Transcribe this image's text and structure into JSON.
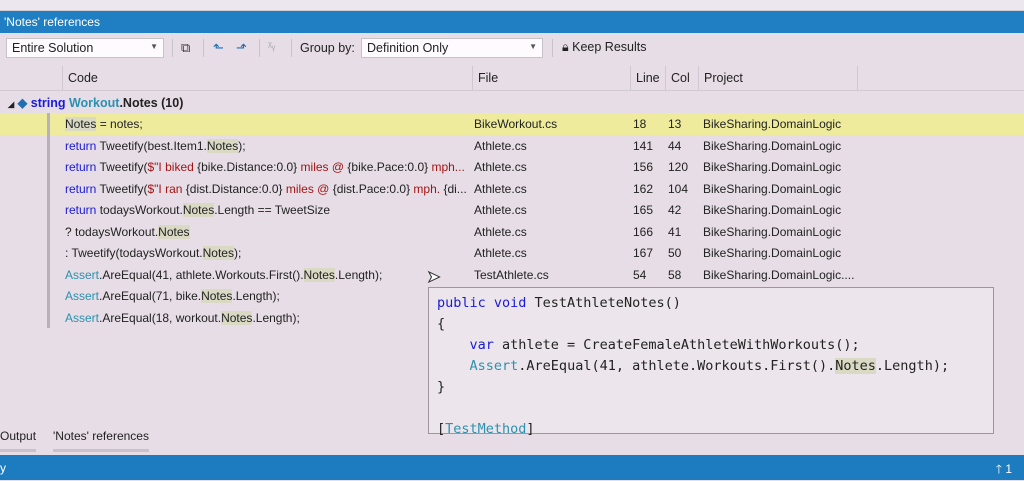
{
  "title": "'Notes' references",
  "toolbar": {
    "scope": "Entire Solution",
    "group_by_label": "Group by:",
    "group_by": "Definition Only",
    "keep_results": "Keep Results"
  },
  "columns": {
    "code": "Code",
    "file": "File",
    "line": "Line",
    "col": "Col",
    "project": "Project"
  },
  "group": {
    "kw": "string",
    "type": "Workout",
    "member": ".Notes",
    "count": "(10)"
  },
  "rows": [
    {
      "code": [
        {
          "t": "Notes",
          "c": "hl"
        },
        {
          "t": " = notes;",
          "c": ""
        }
      ],
      "file": "BikeWorkout.cs",
      "line": "18",
      "col": "13",
      "project": "BikeSharing.DomainLogic",
      "selected": true
    },
    {
      "code": [
        {
          "t": "return",
          "c": "kw"
        },
        {
          "t": " Tweetify(best.Item1.",
          "c": ""
        },
        {
          "t": "Notes",
          "c": "hl"
        },
        {
          "t": ");",
          "c": ""
        }
      ],
      "file": "Athlete.cs",
      "line": "141",
      "col": "44",
      "project": "BikeSharing.DomainLogic"
    },
    {
      "code": [
        {
          "t": "return",
          "c": "kw"
        },
        {
          "t": " Tweetify(",
          "c": ""
        },
        {
          "t": "$\"I biked ",
          "c": "str"
        },
        {
          "t": "{bike.Distance:0.0}",
          "c": ""
        },
        {
          "t": " miles @ ",
          "c": "str"
        },
        {
          "t": "{bike.Pace:0.0}",
          "c": ""
        },
        {
          "t": " mph...",
          "c": "str"
        }
      ],
      "file": "Athlete.cs",
      "line": "156",
      "col": "120",
      "project": "BikeSharing.DomainLogic"
    },
    {
      "code": [
        {
          "t": "return",
          "c": "kw"
        },
        {
          "t": " Tweetify(",
          "c": ""
        },
        {
          "t": "$\"I ran ",
          "c": "str"
        },
        {
          "t": "{dist.Distance:0.0}",
          "c": ""
        },
        {
          "t": " miles @ ",
          "c": "str"
        },
        {
          "t": "{dist.Pace:0.0}",
          "c": ""
        },
        {
          "t": " mph. ",
          "c": "str"
        },
        {
          "t": "{di...",
          "c": ""
        }
      ],
      "file": "Athlete.cs",
      "line": "162",
      "col": "104",
      "project": "BikeSharing.DomainLogic"
    },
    {
      "code": [
        {
          "t": "return",
          "c": "kw"
        },
        {
          "t": " todaysWorkout.",
          "c": ""
        },
        {
          "t": "Notes",
          "c": "hl"
        },
        {
          "t": ".Length == TweetSize",
          "c": ""
        }
      ],
      "file": "Athlete.cs",
      "line": "165",
      "col": "42",
      "project": "BikeSharing.DomainLogic"
    },
    {
      "code": [
        {
          "t": "? todaysWorkout.",
          "c": ""
        },
        {
          "t": "Notes",
          "c": "hl"
        }
      ],
      "file": "Athlete.cs",
      "line": "166",
      "col": "41",
      "project": "BikeSharing.DomainLogic"
    },
    {
      "code": [
        {
          "t": ": Tweetify(todaysWorkout.",
          "c": ""
        },
        {
          "t": "Notes",
          "c": "hl"
        },
        {
          "t": ");",
          "c": ""
        }
      ],
      "file": "Athlete.cs",
      "line": "167",
      "col": "50",
      "project": "BikeSharing.DomainLogic"
    },
    {
      "code": [
        {
          "t": "Assert",
          "c": "ty"
        },
        {
          "t": ".AreEqual(41, athlete.Workouts.First().",
          "c": ""
        },
        {
          "t": "Notes",
          "c": "hl"
        },
        {
          "t": ".Length);",
          "c": ""
        }
      ],
      "file": "TestAthlete.cs",
      "line": "54",
      "col": "58",
      "project": "BikeSharing.DomainLogic...."
    },
    {
      "code": [
        {
          "t": "Assert",
          "c": "ty"
        },
        {
          "t": ".AreEqual(71, bike.",
          "c": ""
        },
        {
          "t": "Notes",
          "c": "hl"
        },
        {
          "t": ".Length);",
          "c": ""
        }
      ],
      "file": "",
      "line": "",
      "col": "",
      "project": ""
    },
    {
      "code": [
        {
          "t": "Assert",
          "c": "ty"
        },
        {
          "t": ".AreEqual(18, workout.",
          "c": ""
        },
        {
          "t": "Notes",
          "c": "hl"
        },
        {
          "t": ".Length);",
          "c": ""
        }
      ],
      "file": "",
      "line": "",
      "col": "",
      "project": ""
    }
  ],
  "tooltip": [
    [
      {
        "t": "public void",
        "c": "kw"
      },
      {
        "t": " TestAthleteNotes()",
        "c": ""
      }
    ],
    [
      {
        "t": "{",
        "c": ""
      }
    ],
    [
      {
        "t": "    ",
        "c": ""
      },
      {
        "t": "var",
        "c": "kw"
      },
      {
        "t": " athlete = CreateFemaleAthleteWithWorkouts();",
        "c": ""
      }
    ],
    [
      {
        "t": "    ",
        "c": ""
      },
      {
        "t": "Assert",
        "c": "ty"
      },
      {
        "t": ".AreEqual(41, athlete.Workouts.First().",
        "c": ""
      },
      {
        "t": "Notes",
        "c": "hl"
      },
      {
        "t": ".Length);",
        "c": ""
      }
    ],
    [
      {
        "t": "}",
        "c": ""
      }
    ],
    [
      {
        "t": "",
        "c": ""
      }
    ],
    [
      {
        "t": "[",
        "c": ""
      },
      {
        "t": "TestMethod",
        "c": "ty"
      },
      {
        "t": "]",
        "c": ""
      }
    ]
  ],
  "bottom_tabs": [
    "Output",
    "'Notes' references"
  ],
  "status": {
    "left": "y",
    "right": "1"
  }
}
